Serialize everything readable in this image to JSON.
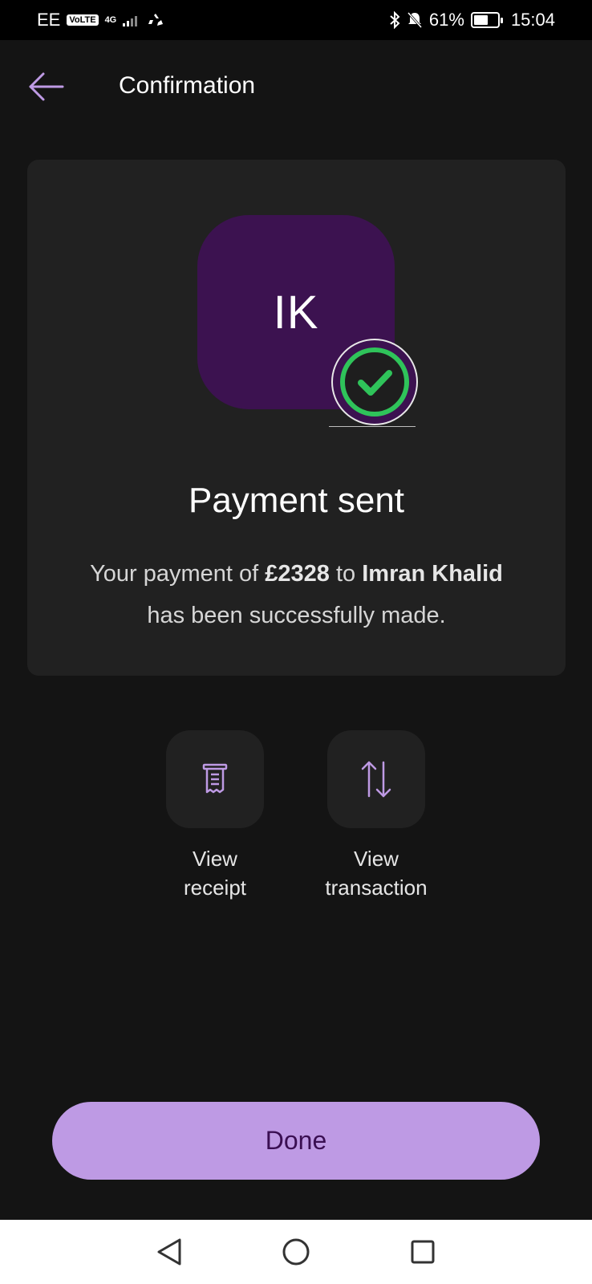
{
  "status_bar": {
    "carrier": "EE",
    "volte": "VoLTE",
    "network": "4G",
    "battery_percent": "61%",
    "battery_level": 0.61,
    "time": "15:04"
  },
  "header": {
    "title": "Confirmation",
    "back_icon": "arrow-left-icon"
  },
  "card": {
    "avatar_initials": "IK",
    "title": "Payment sent",
    "message": {
      "prefix": "Your payment of ",
      "amount": "£2328",
      "middle": " to ",
      "recipient": "Imran Khalid",
      "suffix": " has been successfully made."
    }
  },
  "actions": [
    {
      "label": "View receipt",
      "icon": "receipt-icon"
    },
    {
      "label": "View transaction",
      "icon": "transfer-arrows-icon"
    }
  ],
  "done_button": {
    "label": "Done"
  },
  "colors": {
    "background": "#141414",
    "card": "#212121",
    "avatar": "#3c1250",
    "accent": "#be9ae4",
    "success": "#2fc35a",
    "done_text": "#3a0f52"
  },
  "nav_bar": [
    "back-triangle-icon",
    "home-circle-icon",
    "recents-square-icon"
  ]
}
